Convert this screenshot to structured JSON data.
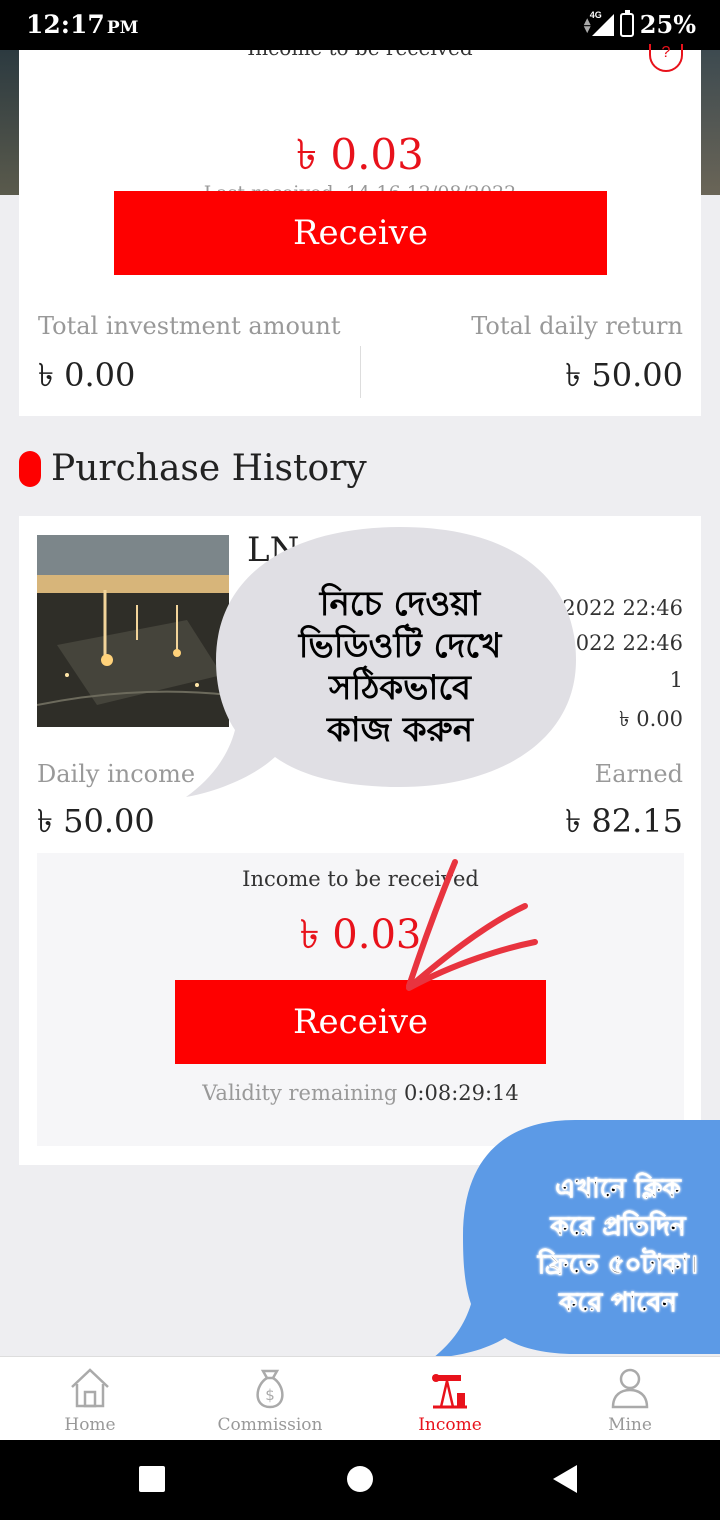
{
  "status_bar": {
    "time": "12:17",
    "ampm": "PM",
    "network": "4G",
    "battery": "25%"
  },
  "summary": {
    "clipped_title": "Income to be received",
    "amount": "৳ 0.03",
    "last_received": "Last received: 14:16 12/08/2022",
    "receive_label": "Receive",
    "total_investment_label": "Total investment amount",
    "total_investment_value": "৳ 0.00",
    "total_daily_return_label": "Total daily return",
    "total_daily_return_value": "৳ 50.00"
  },
  "purchase_history": {
    "title": "Purchase History",
    "product_name": "LN",
    "info_values": [
      "-2022 22:46",
      "2022 22:46",
      "1",
      "৳ 0.00"
    ],
    "daily_income_label": "Daily income",
    "daily_income_value": "৳ 50.00",
    "earned_label": "Earned",
    "earned_value": "৳ 82.15",
    "income_to_receive_label": "Income to be received",
    "income_to_receive_value": "৳ 0.03",
    "receive_label": "Receive",
    "validity_label": "Validity remaining",
    "validity_value": "0:08:29:14"
  },
  "overlays": {
    "grey_bubble_lines": [
      "নিচে দেওয়া",
      "ভিডিওটি দেখে",
      "সঠিকভাবে",
      "কাজ করুন"
    ],
    "blue_bubble_lines": [
      "এখানে ক্লিক",
      "করে প্রতিদিন",
      "ফ্রিতে ৫০টাকা।",
      "করে পাবেন"
    ]
  },
  "bottom_nav": {
    "items": [
      {
        "label": "Home",
        "icon": "home-icon"
      },
      {
        "label": "Commission",
        "icon": "money-bag-icon"
      },
      {
        "label": "Income",
        "icon": "oil-pump-icon",
        "active": true
      },
      {
        "label": "Mine",
        "icon": "person-icon"
      }
    ]
  },
  "colors": {
    "accent": "#fe0000",
    "amount_red": "#e8121b",
    "bubble_grey": "#e0dfe4",
    "bubble_blue": "#5c9ae6"
  }
}
